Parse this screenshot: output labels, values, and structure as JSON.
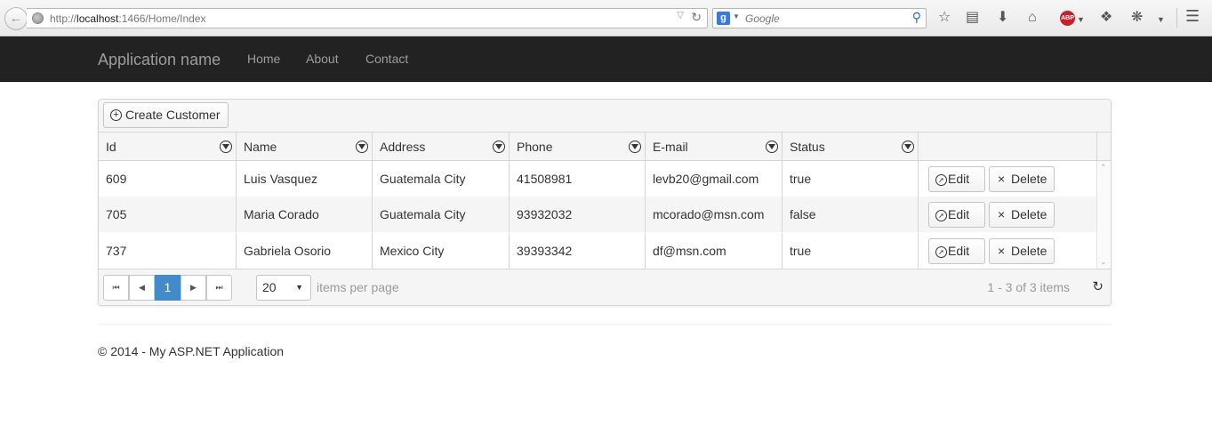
{
  "browser": {
    "url_prefix": "http://",
    "url_host": "localhost",
    "url_path": ":1466/Home/Index",
    "search_placeholder": "Google",
    "search_logo": "g",
    "abp_label": "ABP",
    "icons": [
      "back-arrow-icon",
      "globe-icon",
      "reload-icon",
      "search-icon",
      "star-icon",
      "reader-icon",
      "download-icon",
      "home-icon",
      "adblock-icon",
      "extension-icon",
      "bug-icon",
      "menu-icon"
    ]
  },
  "navbar": {
    "brand": "Application name",
    "links": [
      "Home",
      "About",
      "Contact"
    ]
  },
  "grid": {
    "create_label": "Create Customer",
    "columns": [
      "Id",
      "Name",
      "Address",
      "Phone",
      "E-mail",
      "Status"
    ],
    "rows": [
      [
        "609",
        "Luis Vasquez",
        "Guatemala City",
        "41508981",
        "levb20@gmail.com",
        "true"
      ],
      [
        "705",
        "Maria Corado",
        "Guatemala City",
        "93932032",
        "mcorado@msn.com",
        "false"
      ],
      [
        "737",
        "Gabriela Osorio",
        "Mexico City",
        "39393342",
        "df@msn.com",
        "true"
      ]
    ],
    "edit_label": "Edit",
    "delete_label": "Delete",
    "pager": {
      "current_page": "1",
      "page_size": "20",
      "items_per_page": "items per page",
      "info": "1 - 3 of 3 items"
    }
  },
  "footer": "© 2014 - My ASP.NET Application",
  "colors": {
    "navbar": "#222222",
    "nav_text": "#9d9d9d",
    "active_page": "#428bca"
  }
}
